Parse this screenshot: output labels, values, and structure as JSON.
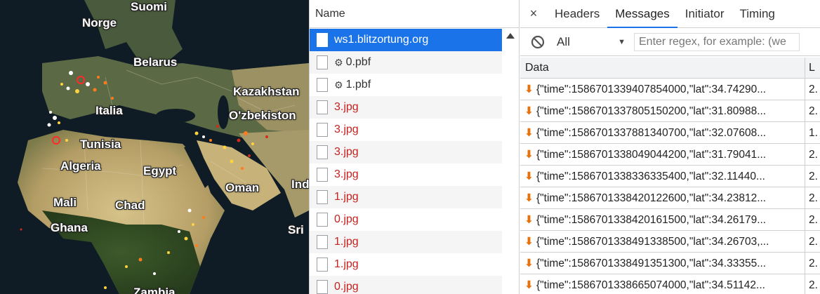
{
  "map": {
    "labels": {
      "suomi": "Suomi",
      "norge": "Norge",
      "belarus": "Belarus",
      "kazakhstan": "Kazakhstan",
      "italia": "Italia",
      "ozbekiston": "O'zbekiston",
      "tunisia": "Tunisia",
      "algeria": "Algeria",
      "egypt": "Egypt",
      "oman": "Oman",
      "india": "Ind",
      "mali": "Mali",
      "chad": "Chad",
      "ghana": "Ghana",
      "srilanka": "Sri",
      "bottom": "Zambia"
    },
    "colors": {
      "ocean": "#0f1c26",
      "land": "#b8a877",
      "strike_hot": "#ffffff",
      "strike_warm": "#ffd23f",
      "strike_cool": "#ff7b1c",
      "strike_old": "#d12c1c"
    }
  },
  "name_panel": {
    "header": "Name",
    "requests": [
      {
        "name": "ws1.blitzortung.org",
        "type": "websocket",
        "state": "selected"
      },
      {
        "name": "0.pbf",
        "type": "pbf",
        "state": "normal"
      },
      {
        "name": "1.pbf",
        "type": "pbf",
        "state": "normal"
      },
      {
        "name": "3.jpg",
        "type": "jpg",
        "state": "error"
      },
      {
        "name": "3.jpg",
        "type": "jpg",
        "state": "error"
      },
      {
        "name": "3.jpg",
        "type": "jpg",
        "state": "error"
      },
      {
        "name": "3.jpg",
        "type": "jpg",
        "state": "error"
      },
      {
        "name": "1.jpg",
        "type": "jpg",
        "state": "error"
      },
      {
        "name": "0.jpg",
        "type": "jpg",
        "state": "error"
      },
      {
        "name": "1.jpg",
        "type": "jpg",
        "state": "error"
      },
      {
        "name": "1.jpg",
        "type": "jpg",
        "state": "error"
      },
      {
        "name": "0.jpg",
        "type": "jpg",
        "state": "error"
      }
    ]
  },
  "detail": {
    "tabs": {
      "close": "×",
      "headers": "Headers",
      "messages": "Messages",
      "initiator": "Initiator",
      "timing": "Timing"
    },
    "filter": {
      "selected": "All",
      "placeholder": "Enter regex, for example: (we"
    },
    "table": {
      "col_data": "Data",
      "col_len": "L",
      "rows": [
        {
          "data": "{\"time\":1586701339407854000,\"lat\":34.74290...",
          "len": "2."
        },
        {
          "data": "{\"time\":1586701337805150200,\"lat\":31.80988...",
          "len": "2."
        },
        {
          "data": "{\"time\":1586701337881340700,\"lat\":32.07608...",
          "len": "1."
        },
        {
          "data": "{\"time\":1586701338049044200,\"lat\":31.79041...",
          "len": "2."
        },
        {
          "data": "{\"time\":1586701338336335400,\"lat\":32.11440...",
          "len": "2."
        },
        {
          "data": "{\"time\":1586701338420122600,\"lat\":34.23812...",
          "len": "2."
        },
        {
          "data": "{\"time\":1586701338420161500,\"lat\":34.26179...",
          "len": "2."
        },
        {
          "data": "{\"time\":1586701338491338500,\"lat\":34.26703,...",
          "len": "2."
        },
        {
          "data": "{\"time\":1586701338491351300,\"lat\":34.33355...",
          "len": "2."
        },
        {
          "data": "{\"time\":1586701338665074000,\"lat\":34.51142...",
          "len": "2."
        }
      ]
    }
  }
}
